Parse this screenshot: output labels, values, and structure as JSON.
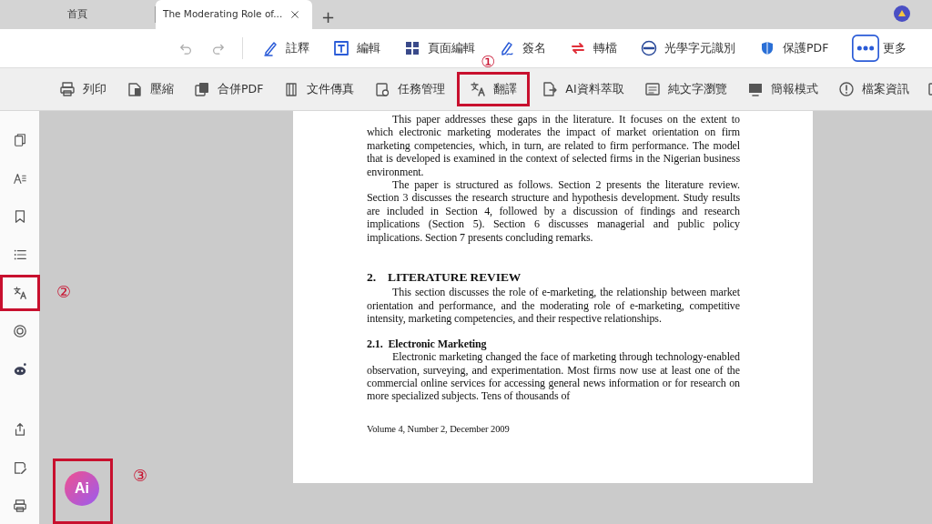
{
  "tabs": [
    {
      "label": "首頁",
      "selected": false,
      "closable": false
    },
    {
      "label": "The Moderating Role of...",
      "selected": true,
      "closable": true
    }
  ],
  "new_tab": "+",
  "main_toolbar": [
    {
      "label": "註釋"
    },
    {
      "label": "編輯"
    },
    {
      "label": "頁面編輯"
    },
    {
      "label": "簽名"
    },
    {
      "label": "轉檔"
    },
    {
      "label": "光學字元識別"
    },
    {
      "label": "保護PDF"
    },
    {
      "label": "更多"
    }
  ],
  "tool_ribbon": [
    {
      "label": "列印",
      "highlighted": false
    },
    {
      "label": "壓縮",
      "highlighted": false
    },
    {
      "label": "合併PDF",
      "highlighted": false
    },
    {
      "label": "文件傳真",
      "highlighted": false
    },
    {
      "label": "任務管理",
      "highlighted": false
    },
    {
      "label": "翻譯",
      "highlighted": true,
      "callout": "①"
    },
    {
      "label": "AI資料萃取",
      "highlighted": false
    },
    {
      "label": "純文字瀏覽",
      "highlighted": false
    },
    {
      "label": "簡報模式",
      "highlighted": false
    },
    {
      "label": "檔案資訊",
      "highlighted": false
    }
  ],
  "sidebar": {
    "items": [
      {
        "highlighted": false
      },
      {
        "highlighted": false
      },
      {
        "highlighted": false
      },
      {
        "highlighted": false
      },
      {
        "highlighted": true,
        "callout": "②"
      },
      {
        "highlighted": false
      },
      {
        "highlighted": false
      },
      {
        "highlighted": false
      },
      {
        "highlighted": false
      },
      {
        "highlighted": false
      }
    ]
  },
  "document": {
    "blocks": [
      {
        "kind": "paragraph",
        "text": "This paper addresses these gaps in the literature.  It focuses on the extent to which electronic marketing moderates the impact of market orientation on firm marketing competencies, which, in turn, are related to firm performance. The model that is developed is examined in the context of selected firms in the Nigerian business environment."
      },
      {
        "kind": "paragraph",
        "text": "The paper is structured as follows.  Section 2 presents the literature review. Section 3 discusses the research structure and hypothesis development.  Study results are included in Section 4, followed by a discussion of findings and research implications (Section 5).  Section 6 discusses managerial and public policy implications.  Section 7 presents concluding remarks."
      },
      {
        "kind": "heading",
        "number": "2.",
        "text": "LITERATURE REVIEW"
      },
      {
        "kind": "paragraph",
        "text": "This section discusses the role of e-marketing, the relationship between market orientation and performance, and the moderating role of e-marketing, competitive intensity, marketing competencies, and their respective relationships."
      },
      {
        "kind": "subheading",
        "number": "2.1.",
        "text": "Electronic Marketing"
      },
      {
        "kind": "paragraph",
        "text": "Electronic marketing changed the face of marketing through technology-enabled observation, surveying, and experimentation.  Most firms now use at least one of the commercial online services for accessing general news information or for research on more specialized subjects.  Tens of thousands of"
      },
      {
        "kind": "footer",
        "text": "Volume 4, Number 2, December 2009"
      }
    ]
  },
  "ai_button": {
    "label": "Ai",
    "highlighted": true,
    "callout": "③"
  }
}
